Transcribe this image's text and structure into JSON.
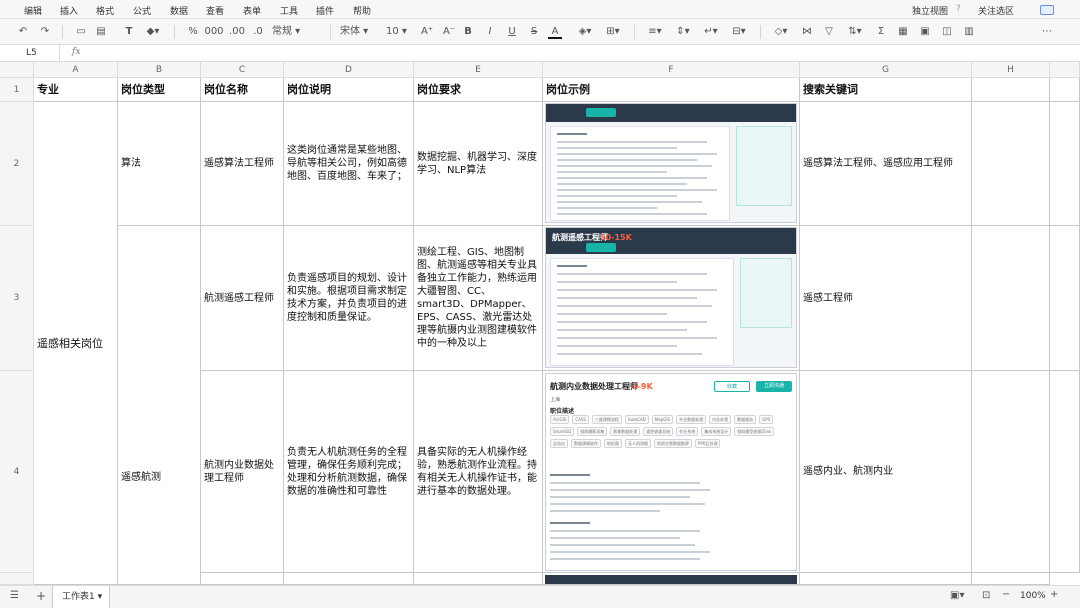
{
  "menu": {
    "items": [
      "编辑",
      "插入",
      "格式",
      "公式",
      "数据",
      "查看",
      "表单",
      "工具",
      "插件",
      "帮助"
    ],
    "view_mode": "独立视图",
    "follow": "关注选区"
  },
  "toolbar": {
    "percent": "%",
    "thousands": "000",
    "dec_dec": ".00",
    "dec_inc": ".0",
    "number_format": "常规",
    "font": "宋体",
    "font_size": "10",
    "bold": "B",
    "italic": "I",
    "underline": "U",
    "strike": "S",
    "font_color": "A"
  },
  "formula_bar": {
    "cell_ref": "L5",
    "fx": "fx",
    "content": ""
  },
  "columns": [
    "A",
    "B",
    "C",
    "D",
    "E",
    "F",
    "G",
    "H"
  ],
  "rows": [
    "1",
    "2",
    "3",
    "4"
  ],
  "header_row": {
    "a": "专业",
    "b": "岗位类型",
    "c": "岗位名称",
    "d": "岗位说明",
    "e": "岗位要求",
    "f": "岗位示例",
    "g": "搜索关键词"
  },
  "rows_data": {
    "major": "遥感相关岗位",
    "r2": {
      "type": "算法",
      "name": "遥感算法工程师",
      "desc": "这类岗位通常是某些地图、导航等相关公司，例如高德地图、百度地图、车来了；",
      "req": "数据挖掘、机器学习、深度学习、NLP算法",
      "keywords": "遥感算法工程师、遥感应用工程师"
    },
    "r3": {
      "name": "航测遥感工程师",
      "desc": "负责遥感项目的规划、设计和实施。根据项目需求制定技术方案，并负责项目的进度控制和质量保证。",
      "req": "测绘工程、GIS、地图制图、航测遥感等相关专业具备独立工作能力，熟练运用大疆智图、CC、smart3D、DPMapper、EPS、CASS、激光雷达处理等航摄内业测图建模软件中的一种及以上",
      "keywords": "遥感工程师",
      "shot_title": "航测遥感工程师",
      "shot_salary": "10-15K"
    },
    "r4": {
      "type": "遥感航测",
      "name": "航测内业数据处理工程师",
      "desc": "负责无人机航测任务的全程管理，确保任务顺利完成；处理和分析航测数据，确保数据的准确性和可靠性",
      "req": "具备实际的无人机操作经验，熟悉航测作业流程。持有相关无人机操作证书，能进行基本的数据处理。",
      "keywords": "遥感内业、航测内业",
      "shot_title": "航测内业数据处理工程师",
      "shot_salary": "4-9K",
      "shot_city": "上海",
      "shot_section": "职位描述",
      "shot_tags": [
        "ArcGIS",
        "CASS",
        "三维建模流程",
        "AutoCAD",
        "MapGIS",
        "外业数据处理",
        "内业处理",
        "数据服务",
        "GPS",
        "SmartGD",
        "倾斜摄影采集",
        "影像数据处理",
        "遥控调查总结",
        "作业系统",
        "集成系统设计",
        "倾斜模型修复Dlink",
        "全站仪",
        "数据建模软件",
        "地形图",
        "无人机测图",
        "地质灾害数据勘察",
        "PPK后处理"
      ],
      "shot_btn_save": "收藏",
      "shot_btn_chat": "立即沟通"
    }
  },
  "sheet_tab": "工作表1",
  "zoom": "100%"
}
